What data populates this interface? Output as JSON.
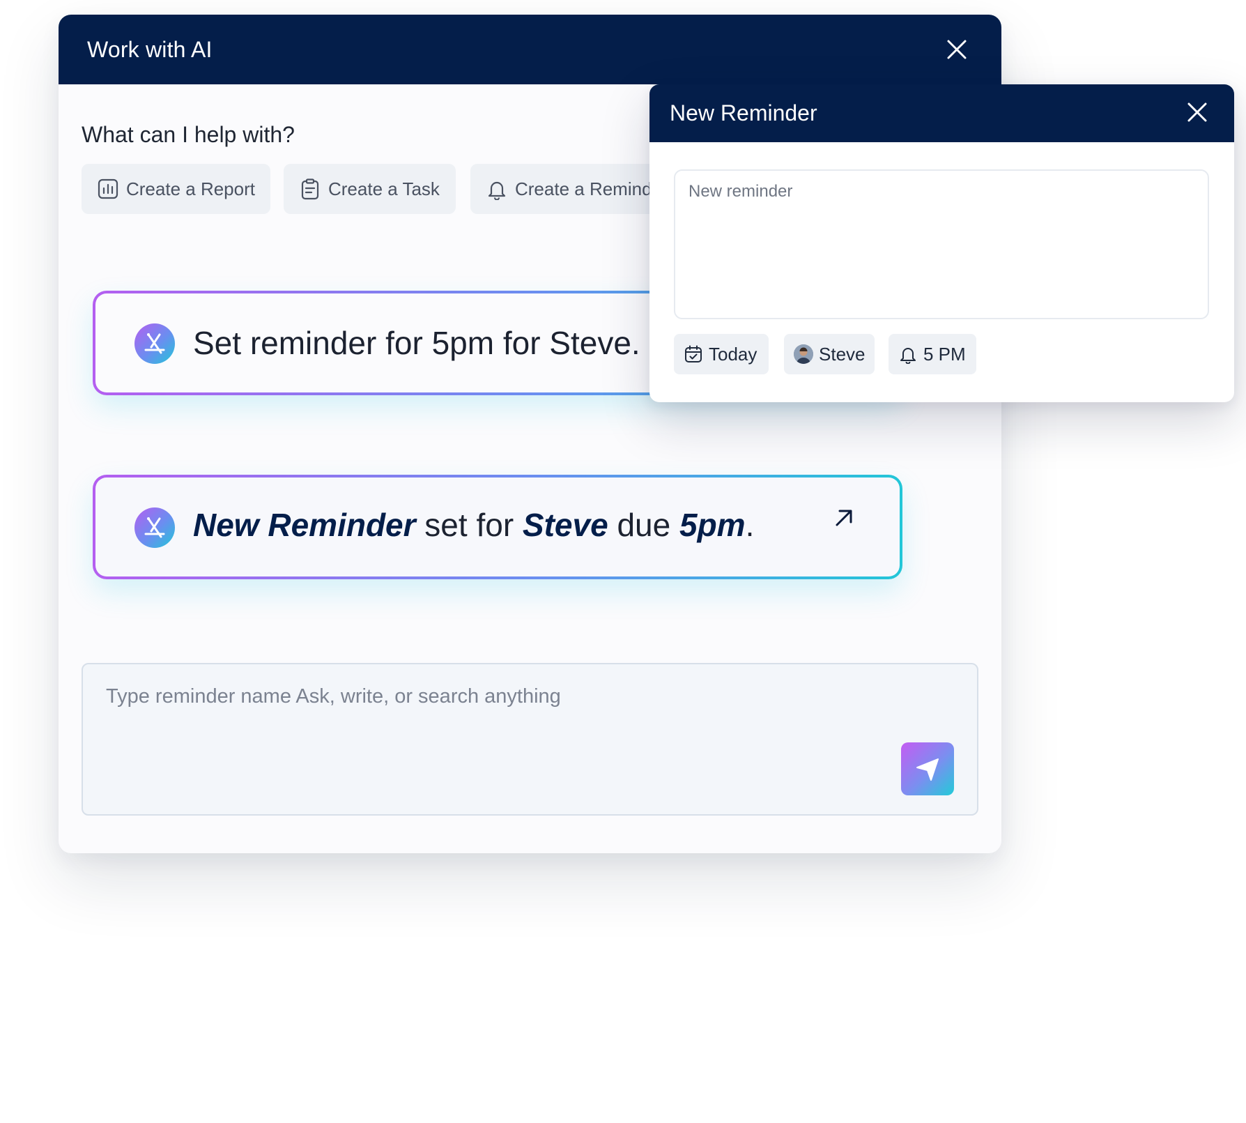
{
  "main_dialog": {
    "title": "Work with AI",
    "help_heading": "What can I help with?",
    "chips": [
      {
        "label": "Create a Report",
        "icon": "bar-chart-icon"
      },
      {
        "label": "Create a Task",
        "icon": "clipboard-icon"
      },
      {
        "label": "Create a Reminder",
        "icon": "bell-icon"
      }
    ],
    "prompt_card": {
      "text": "Set reminder for 5pm for Steve."
    },
    "result_card": {
      "part1": "New Reminder",
      "part2": " set for ",
      "part3": "Steve",
      "part4": " due ",
      "part5": "5pm",
      "part6": "."
    },
    "chat_input": {
      "placeholder": "Type reminder name Ask, write, or search anything"
    }
  },
  "reminder_dialog": {
    "title": "New Reminder",
    "textarea_placeholder": "New reminder",
    "date_label": "Today",
    "assignee_label": "Steve",
    "time_label": "5 PM"
  },
  "colors": {
    "header_navy": "#041e4a",
    "gradient_start": "#b45ff0",
    "gradient_mid": "#6a8ef0",
    "gradient_end": "#22c6d8",
    "chip_bg": "#eef1f5"
  }
}
